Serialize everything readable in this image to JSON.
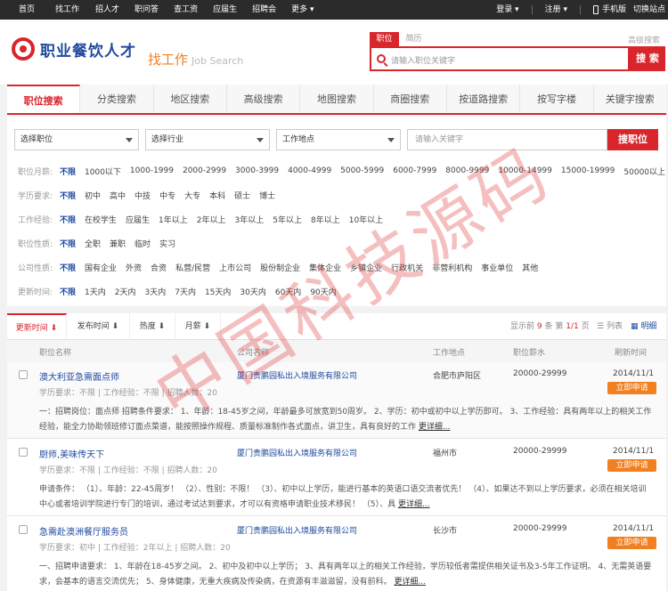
{
  "topbar": {
    "nav": [
      "首页",
      "找工作",
      "招人才",
      "职问答",
      "查工资",
      "应届生",
      "招聘会",
      "更多 ▾"
    ],
    "login": "登录 ▾",
    "register": "注册 ▾",
    "mobile": "手机版",
    "switch_site": "切换站点"
  },
  "header": {
    "logo_text": "职业餐饮人才",
    "find_job": "找工作",
    "find_job_en": "Job Search",
    "search_tabs": [
      "职位",
      "简历"
    ],
    "advanced": "高级搜索",
    "search_placeholder": "请输入职位关键字",
    "search_button": "搜 索"
  },
  "tabs": [
    "职位搜索",
    "分类搜索",
    "地区搜索",
    "高级搜索",
    "地图搜索",
    "商圈搜索",
    "按道路搜索",
    "按写字楼",
    "关键字搜索"
  ],
  "filter": {
    "select_position": "选择职位",
    "select_industry": "选择行业",
    "work_location": "工作地点",
    "keyword_placeholder": "请输入关键字",
    "search_button": "搜职位",
    "rows": [
      {
        "label": "职位月薪:",
        "options": [
          "不限",
          "1000以下",
          "1000-1999",
          "2000-2999",
          "3000-3999",
          "4000-4999",
          "5000-5999",
          "6000-7999",
          "8000-9999",
          "10000-14999",
          "15000-19999",
          "50000以上"
        ]
      },
      {
        "label": "学历要求:",
        "options": [
          "不限",
          "初中",
          "高中",
          "中技",
          "中专",
          "大专",
          "本科",
          "硕士",
          "博士"
        ]
      },
      {
        "label": "工作经验:",
        "options": [
          "不限",
          "在校学生",
          "应届生",
          "1年以上",
          "2年以上",
          "3年以上",
          "5年以上",
          "8年以上",
          "10年以上"
        ]
      },
      {
        "label": "职位性质:",
        "options": [
          "不限",
          "全职",
          "兼职",
          "临时",
          "实习"
        ]
      },
      {
        "label": "公司性质:",
        "options": [
          "不限",
          "国有企业",
          "外资",
          "合资",
          "私营/民营",
          "上市公司",
          "股份制企业",
          "集体企业",
          "乡镇企业",
          "行政机关",
          "非营利机构",
          "事业单位",
          "其他"
        ]
      },
      {
        "label": "更新时间:",
        "options": [
          "不限",
          "1天内",
          "2天内",
          "3天内",
          "7天内",
          "15天内",
          "30天内",
          "60天内",
          "90天内"
        ]
      }
    ]
  },
  "sortbar": {
    "sorts": [
      "更新时间 ⬇",
      "发布时间 ⬇",
      "热度 ⬇",
      "月薪 ⬇"
    ],
    "showing_prefix": "显示前",
    "showing_count": "9",
    "showing_mid": "条  第",
    "page": "1/1",
    "page_suffix": "页",
    "view_list": "列表",
    "view_detail": "明细"
  },
  "columns": [
    "职位名称",
    "公司名称",
    "工作地点",
    "职位薪水",
    "刷新时间"
  ],
  "jobs": [
    {
      "title": "澳大利亚急需面点师",
      "company": "厦门贵鹏园私出入境服务有限公司",
      "location": "合肥市庐阳区",
      "salary": "20000-29999",
      "date": "2014/11/1",
      "requirements": "学历要求：不限 | 工作经验：不限 | 招聘人数：20",
      "apply": "立即申请",
      "description": "一：招聘岗位：面点师  招聘条件要求：  1、年龄：18-45岁之间，年龄最多可放宽到50周岁。  2、学历：初中或初中以上学历即可。  3、工作经验：具有两年以上的相关工作经验，能全力协助领班修订面点菜谱，能按照操作规程、质量标准制作各式面点，讲卫生，具有良好的工作",
      "more": "更详细..."
    },
    {
      "title": "厨师,美味传天下",
      "company": "厦门贵鹏园私出入境服务有限公司",
      "location": "福州市",
      "salary": "20000-29999",
      "date": "2014/11/1",
      "requirements": "学历要求：不限 | 工作经验：不限 | 招聘人数：20",
      "apply": "立即申请",
      "description": "申请条件：  （1）、年龄：22-45周岁！  （2）、性别：不限！  （3）、初中以上学历，能进行基本的英语口语交流者优先！  （4）、如果达不到以上学历要求，必须在相关培训中心或者培训学院进行专门的培训，通过考试达到要求，才可以有资格申请职业技术移民！  （5）、具",
      "more": "更详细..."
    },
    {
      "title": "急需赴澳洲餐厅服务员",
      "company": "厦门贵鹏园私出入境服务有限公司",
      "location": "长沙市",
      "salary": "20000-29999",
      "date": "2014/11/1",
      "requirements": "学历要求：初中 | 工作经验：2年以上 | 招聘人数：20",
      "apply": "立即申请",
      "description": "一、招聘申请要求：  1、年龄在18-45岁之间。  2、初中及初中以上学历；  3、具有两年以上的相关工作经验，学历较低者需提供相关证书及3-5年工作证明。  4、无需英语要求，会基本的语言交流优先；  5、身体健康，无重大疾病及传染病，在资源有丰滋滋留，没有前科。",
      "more": "更详细..."
    }
  ],
  "watermark": "中国科技源码"
}
